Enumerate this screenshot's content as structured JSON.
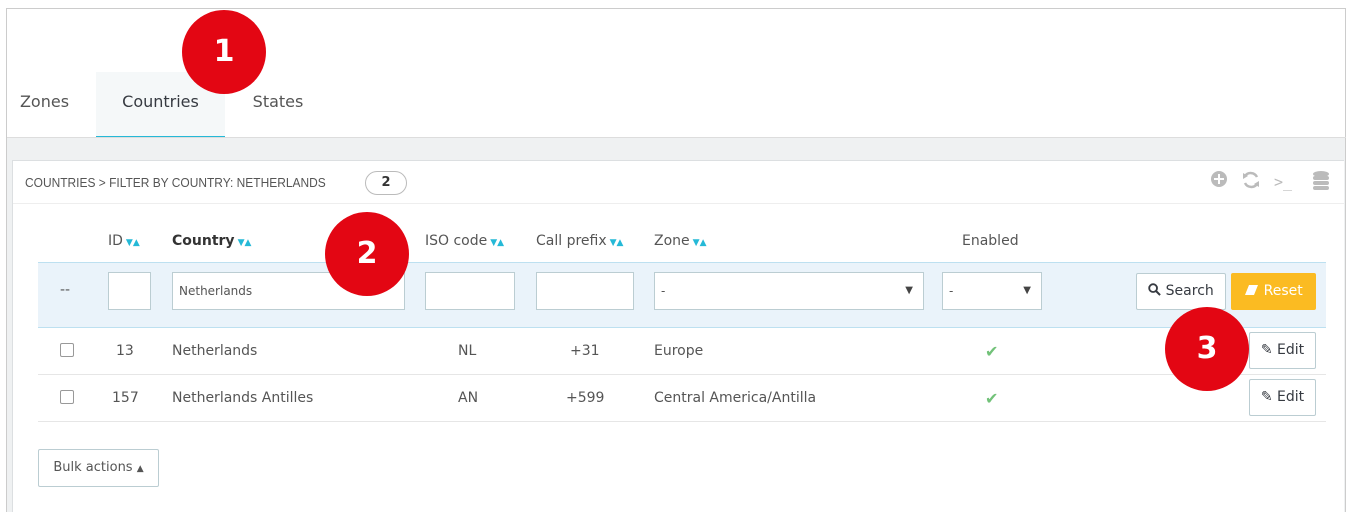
{
  "tabs": [
    {
      "label": "Zones",
      "active": false
    },
    {
      "label": "Countries",
      "active": true
    },
    {
      "label": "States",
      "active": false
    }
  ],
  "panel": {
    "breadcrumb": "COUNTRIES > FILTER BY COUNTRY: NETHERLANDS",
    "count": "2",
    "toolbar_icons": [
      "add-icon",
      "refresh-icon",
      "sql-query-icon",
      "database-icon"
    ]
  },
  "table": {
    "headers": {
      "id": "ID",
      "country": "Country",
      "iso": "ISO code",
      "prefix": "Call prefix",
      "zone": "Zone",
      "enabled": "Enabled"
    },
    "filters": {
      "bulk": "--",
      "id": "",
      "country": "Netherlands",
      "iso": "",
      "prefix": "",
      "zone": "-",
      "enabled": "-"
    },
    "search_label": "Search",
    "reset_label": "Reset",
    "rows": [
      {
        "id": "13",
        "country": "Netherlands",
        "iso": "NL",
        "prefix": "+31",
        "zone": "Europe",
        "enabled": true,
        "action": "Edit"
      },
      {
        "id": "157",
        "country": "Netherlands Antilles",
        "iso": "AN",
        "prefix": "+599",
        "zone": "Central America/Antilla",
        "enabled": true,
        "action": "Edit"
      }
    ],
    "bulk_actions": "Bulk actions"
  },
  "markers": [
    "1",
    "2",
    "3"
  ],
  "colors": {
    "accent": "#25b9d7",
    "reset": "#fbbb22",
    "marker": "#e30613",
    "check": "#72c279"
  }
}
